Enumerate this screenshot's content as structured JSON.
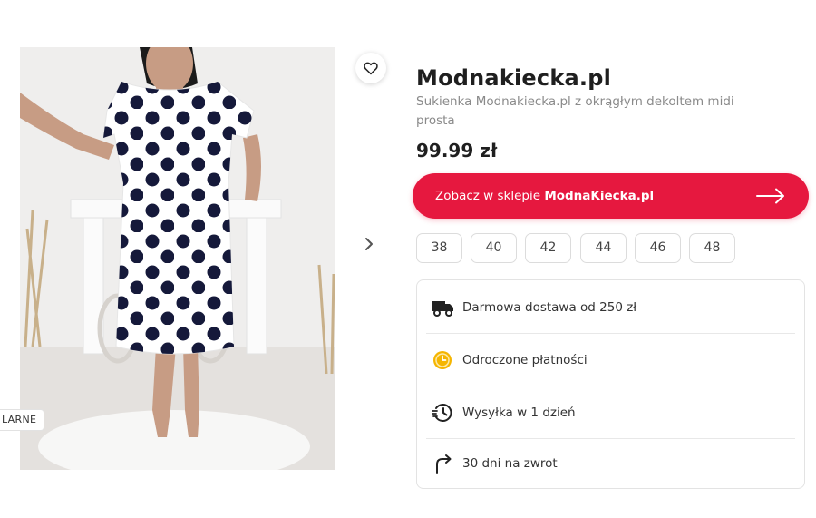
{
  "product": {
    "shop_name": "Modnakiecka.pl",
    "description": "Sukienka Modnakiecka.pl z okrągłym dekoltem midi prosta",
    "price": "99.99 zł",
    "image_badge": "LARNE",
    "favorite_icon": "heart-icon",
    "next_icon": "chevron-right-icon"
  },
  "cta": {
    "prefix": "Zobacz w sklepie",
    "shop": "ModnaKiecka.pl",
    "icon": "arrow-right-icon",
    "color": "#e6183f"
  },
  "sizes": [
    "38",
    "40",
    "42",
    "44",
    "46",
    "48"
  ],
  "features": [
    {
      "label": "Darmowa dostawa od 250 zł",
      "icon": "truck-icon"
    },
    {
      "label": "Odroczone płatności",
      "icon": "coin-clock-icon"
    },
    {
      "label": "Wysyłka w 1 dzień",
      "icon": "fast-clock-icon"
    },
    {
      "label": "30 dni na zwrot",
      "icon": "return-arrow-icon"
    }
  ]
}
